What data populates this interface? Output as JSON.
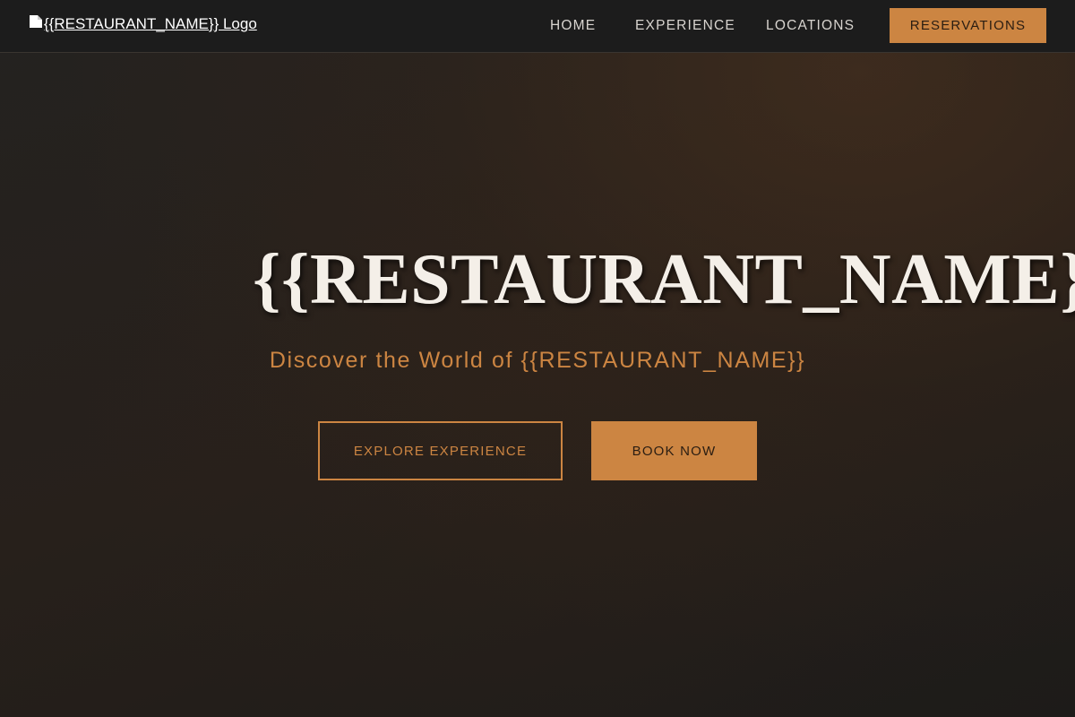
{
  "header": {
    "logo_alt": "{{RESTAURANT_NAME}} Logo",
    "logo_icon": "broken-image-icon",
    "nav": [
      {
        "label": "HOME"
      },
      {
        "label": "EXPERIENCE"
      },
      {
        "label": "LOCATIONS"
      }
    ],
    "reservations_label": "RESERVATIONS"
  },
  "hero": {
    "title": "{{RESTAURANT_NAME}}",
    "subtitle": "Discover the World of {{RESTAURANT_NAME}}",
    "explore_label": "EXPLORE EXPERIENCE",
    "book_label": "BOOK NOW"
  },
  "colors": {
    "accent": "#cc8542",
    "header_bg": "#1c1c1c",
    "page_bg": "#221e1b",
    "title_text": "#f4efe8"
  }
}
